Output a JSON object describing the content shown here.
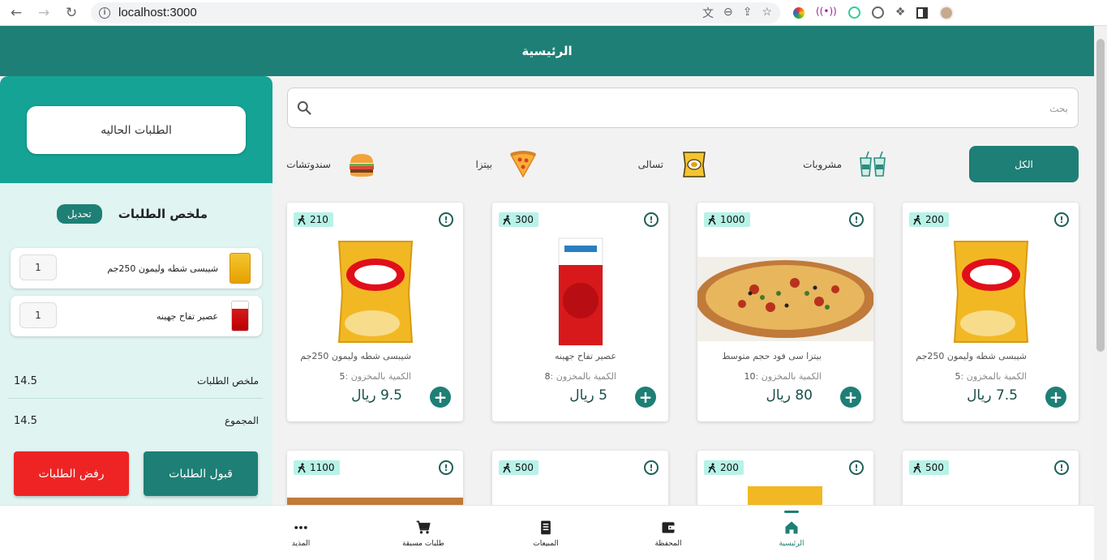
{
  "browser": {
    "url": "localhost:3000"
  },
  "appbar": {
    "title": "الرئيسية"
  },
  "orders_panel": {
    "current_orders_label": "الطلبات الحاليه",
    "summary_title": "ملخص الطلبات",
    "edit_label": "تحديل",
    "items": [
      {
        "name": "شيبسى شطه وليمون 250جم",
        "qty": "1"
      },
      {
        "name": "عصير تفاح جهينه",
        "qty": "1"
      }
    ],
    "subtotal_label": "ملخص الطلبات",
    "subtotal_value": "14.5",
    "total_label": "المجموع",
    "total_value": "14.5",
    "accept_label": "قبول الطلبات",
    "reject_label": "رفض الطلبات"
  },
  "search": {
    "placeholder": "بحث"
  },
  "categories": [
    {
      "label": "الكل"
    },
    {
      "label": "مشروبات"
    },
    {
      "label": "تسالى"
    },
    {
      "label": "بيتزا"
    },
    {
      "label": "سندوتشات"
    }
  ],
  "products": [
    {
      "name": "شيبسى شطه وليمون 250جم",
      "stock_label": "الكمية بالمخزون :",
      "stock": "5",
      "price": "7.5 ريال",
      "time": "200"
    },
    {
      "name": "بيتزا سى فود حجم متوسط",
      "stock_label": "الكمية بالمخزون :",
      "stock": "10",
      "price": "80 ريال",
      "time": "1000"
    },
    {
      "name": "عصير تفاح جهينه",
      "stock_label": "الكمية بالمخزون :",
      "stock": "8",
      "price": "5 ريال",
      "time": "300"
    },
    {
      "name": "شيبسى شطه وليمون 250جم",
      "stock_label": "الكمية بالمخزون :",
      "stock": "5",
      "price": "9.5 ريال",
      "time": "210"
    },
    {
      "time": "500"
    },
    {
      "time": "200"
    },
    {
      "time": "500"
    },
    {
      "time": "1100"
    }
  ],
  "bottom_nav": [
    {
      "label": "الرئيسية",
      "icon": "home-icon"
    },
    {
      "label": "المحفظة",
      "icon": "wallet-icon"
    },
    {
      "label": "المبيعات",
      "icon": "receipt-icon"
    },
    {
      "label": "طلبات مسبقة",
      "icon": "cart-icon"
    },
    {
      "label": "المذيد",
      "icon": "more-icon"
    }
  ],
  "colors": {
    "primary": "#1e7f76",
    "panel_head": "#14a395",
    "panel_bg": "#e0f4f1",
    "reject": "#ee2424",
    "time_badge": "#b7f2e8"
  }
}
